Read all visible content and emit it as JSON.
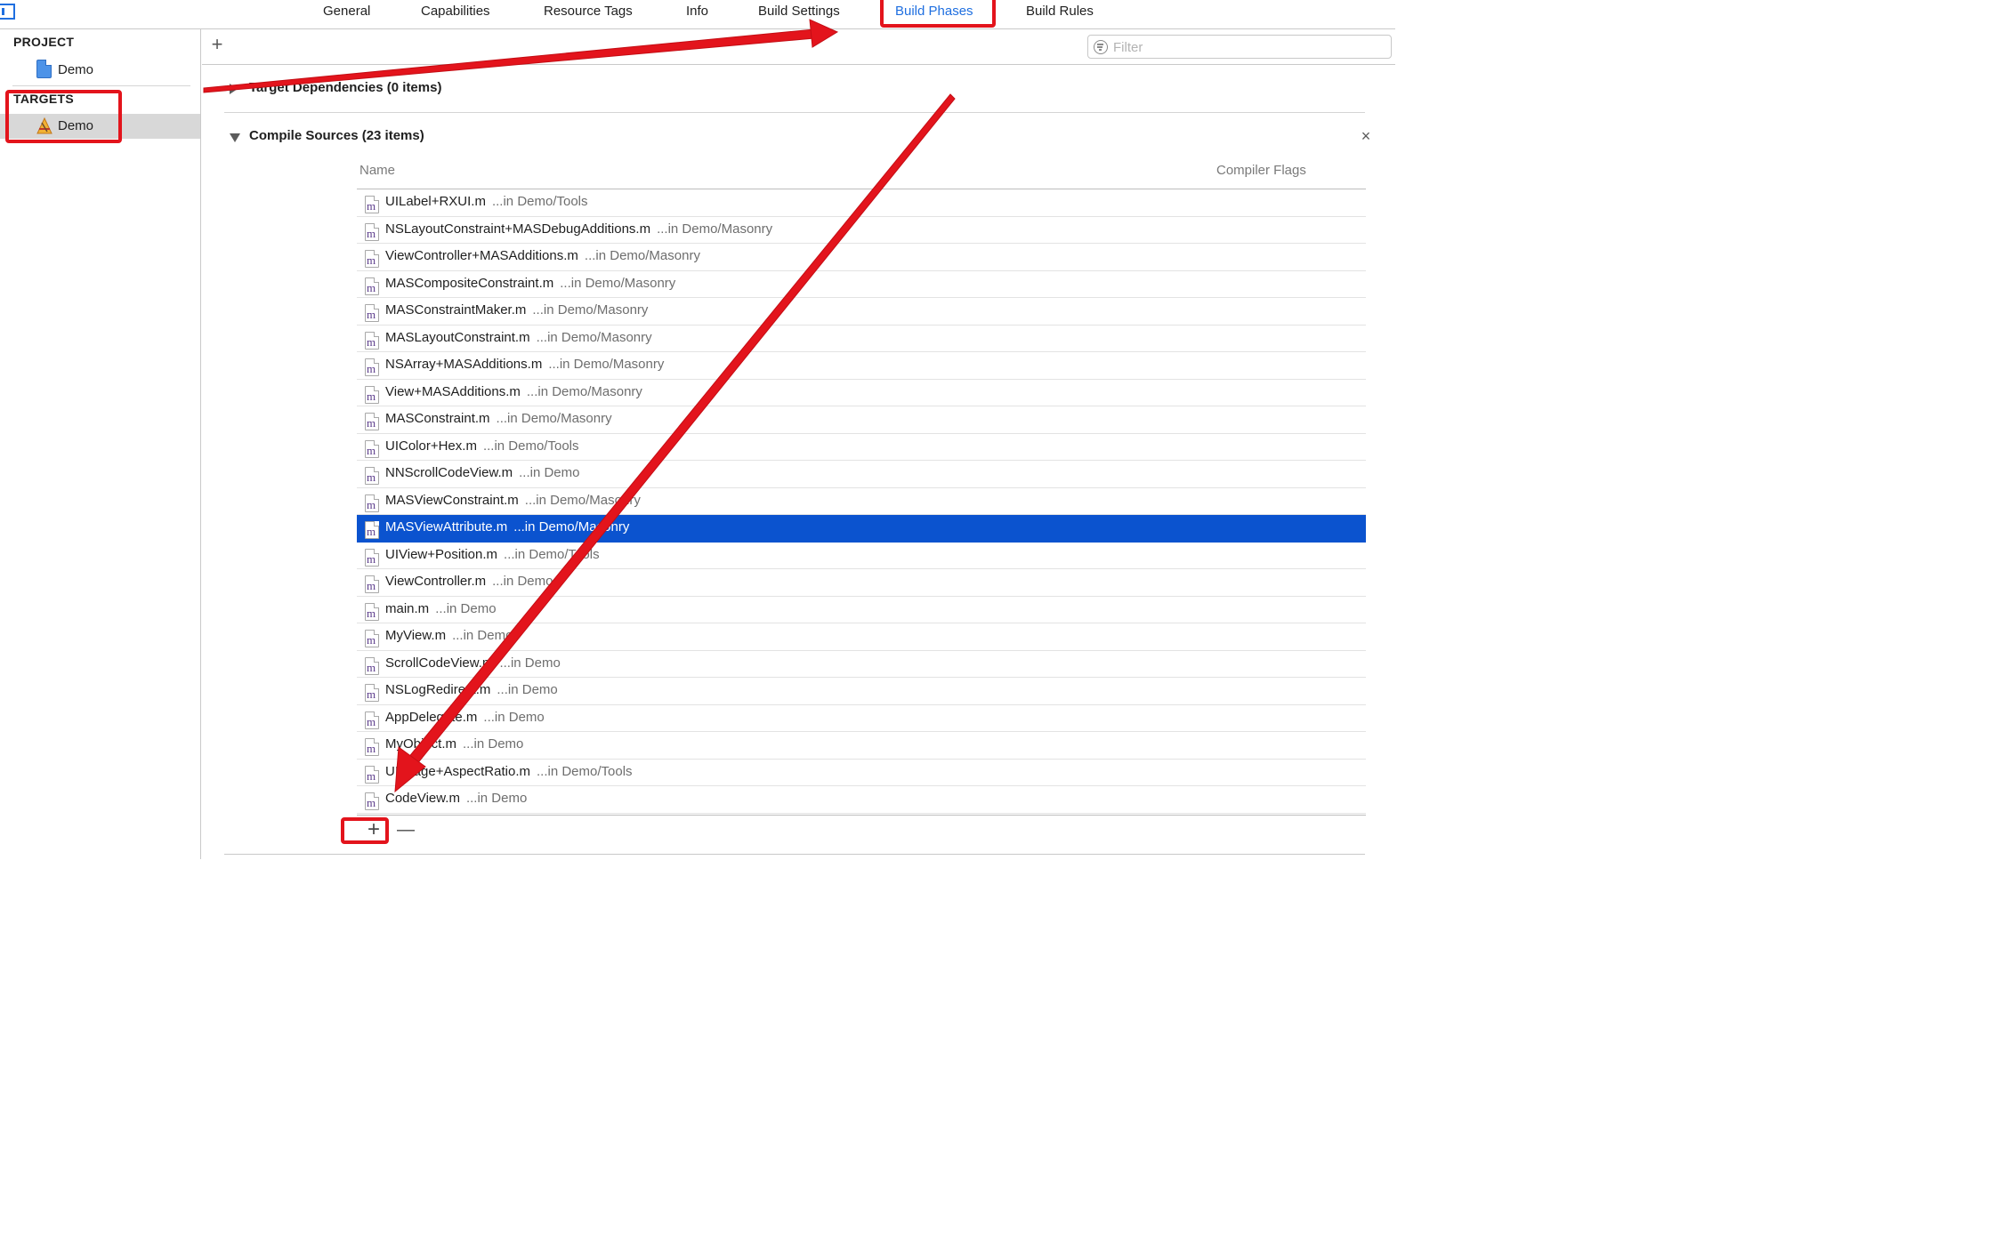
{
  "tabs": [
    {
      "label": "General",
      "active": false
    },
    {
      "label": "Capabilities",
      "active": false
    },
    {
      "label": "Resource Tags",
      "active": false
    },
    {
      "label": "Info",
      "active": false
    },
    {
      "label": "Build Settings",
      "active": false
    },
    {
      "label": "Build Phases",
      "active": true
    },
    {
      "label": "Build Rules",
      "active": false
    }
  ],
  "sidebar": {
    "project_header": "PROJECT",
    "project_item": "Demo",
    "targets_header": "TARGETS",
    "target_item": "Demo"
  },
  "toolbar": {
    "add_symbol": "+",
    "filter_placeholder": "Filter"
  },
  "phases": {
    "target_dependencies": "Target Dependencies (0 items)",
    "compile_sources": "Compile Sources (23 items)",
    "remove_symbol": "×"
  },
  "table": {
    "name_header": "Name",
    "flags_header": "Compiler Flags",
    "rows": [
      {
        "name": "UILabel+RXUI.m",
        "path": "...in Demo/Tools"
      },
      {
        "name": "NSLayoutConstraint+MASDebugAdditions.m",
        "path": "...in Demo/Masonry"
      },
      {
        "name": "ViewController+MASAdditions.m",
        "path": "...in Demo/Masonry"
      },
      {
        "name": "MASCompositeConstraint.m",
        "path": "...in Demo/Masonry"
      },
      {
        "name": "MASConstraintMaker.m",
        "path": "...in Demo/Masonry"
      },
      {
        "name": "MASLayoutConstraint.m",
        "path": "...in Demo/Masonry"
      },
      {
        "name": "NSArray+MASAdditions.m",
        "path": "...in Demo/Masonry"
      },
      {
        "name": "View+MASAdditions.m",
        "path": "...in Demo/Masonry"
      },
      {
        "name": "MASConstraint.m",
        "path": "...in Demo/Masonry"
      },
      {
        "name": "UIColor+Hex.m",
        "path": "...in Demo/Tools"
      },
      {
        "name": "NNScrollCodeView.m",
        "path": "...in Demo"
      },
      {
        "name": "MASViewConstraint.m",
        "path": "...in Demo/Masonry"
      },
      {
        "name": "MASViewAttribute.m",
        "path": "...in Demo/Masonry",
        "selected": true
      },
      {
        "name": "UIView+Position.m",
        "path": "...in Demo/Tools"
      },
      {
        "name": "ViewController.m",
        "path": "...in Demo"
      },
      {
        "name": "main.m",
        "path": "...in Demo"
      },
      {
        "name": "MyView.m",
        "path": "...in Demo"
      },
      {
        "name": "ScrollCodeView.m",
        "path": "...in Demo"
      },
      {
        "name": "NSLogRedirect.m",
        "path": "...in Demo"
      },
      {
        "name": "AppDelegate.m",
        "path": "...in Demo"
      },
      {
        "name": "MyObject.m",
        "path": "...in Demo"
      },
      {
        "name": "UIImage+AspectRatio.m",
        "path": "...in Demo/Tools"
      },
      {
        "name": "CodeView.m",
        "path": "...in Demo"
      }
    ],
    "file_icon_letter": "m",
    "add_symbol": "+",
    "remove_symbol": "—"
  },
  "colors": {
    "accent": "#1f6fe0",
    "selection": "#0b53cf",
    "annotation": "#e3141c"
  }
}
